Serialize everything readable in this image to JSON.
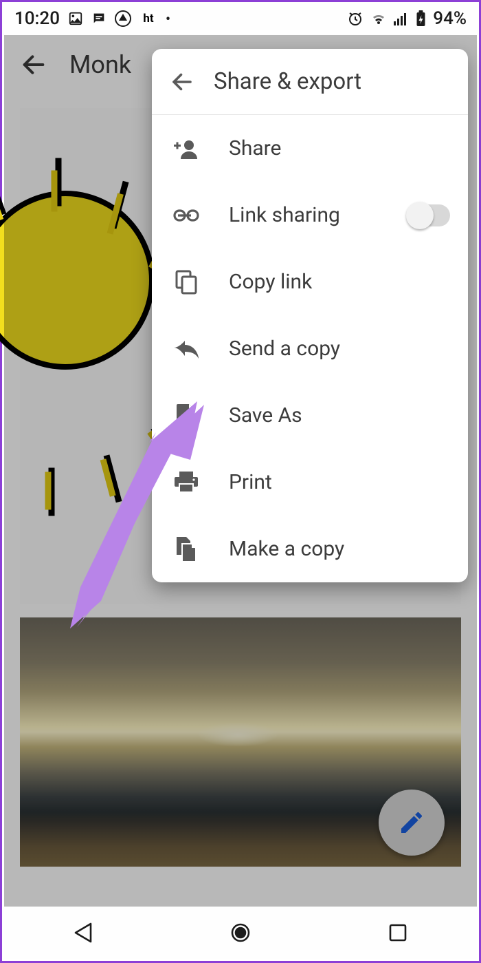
{
  "statusbar": {
    "time": "10:20",
    "battery": "94%",
    "icons": {
      "image": "image-icon",
      "messages": "messages-icon",
      "adaway": "adaway-icon",
      "ht": "ht",
      "more": "•",
      "alarm": "alarm-icon",
      "wifi": "wifi-icon",
      "signal": "signal-icon",
      "battery_icon": "battery-icon"
    }
  },
  "header": {
    "title": "Monk"
  },
  "sheet": {
    "title": "Share & export",
    "items": [
      {
        "icon": "person-add-icon",
        "label": "Share"
      },
      {
        "icon": "link-icon",
        "label": "Link sharing",
        "toggle": false
      },
      {
        "icon": "copy-icon",
        "label": "Copy link"
      },
      {
        "icon": "send-icon",
        "label": "Send a copy"
      },
      {
        "icon": "file-icon",
        "label": "Save As"
      },
      {
        "icon": "print-icon",
        "label": "Print"
      },
      {
        "icon": "filecopy-icon",
        "label": "Make a copy"
      }
    ]
  },
  "fab": {
    "icon": "pencil-icon"
  },
  "annotation": {
    "target": "Save As"
  }
}
